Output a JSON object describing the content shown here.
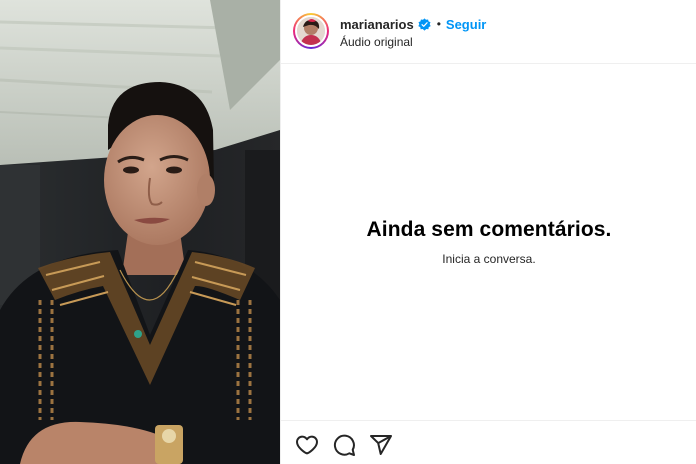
{
  "post": {
    "header": {
      "username": "marianarios",
      "verified_icon": "verified-badge-icon",
      "separator": "•",
      "follow_label": "Seguir",
      "audio_label": "Áudio original"
    },
    "comments": {
      "empty_title": "Ainda sem comentários.",
      "empty_subtitle": "Inicia a conversa."
    },
    "actions": [
      {
        "name": "like",
        "icon": "heart-icon"
      },
      {
        "name": "comment",
        "icon": "comment-icon"
      },
      {
        "name": "share",
        "icon": "paper-plane-icon"
      }
    ],
    "colors": {
      "link_blue": "#0095f6",
      "text_primary": "#262626",
      "divider": "#efefef"
    }
  }
}
